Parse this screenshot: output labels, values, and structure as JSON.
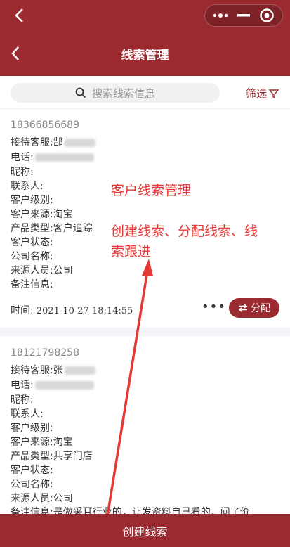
{
  "header": {
    "title": "线索管理"
  },
  "search": {
    "placeholder": "搜索线索信息",
    "filter_label": "筛选"
  },
  "cards": [
    {
      "phone": "18366856689",
      "fields": [
        {
          "label": "接待客服:",
          "value": "郜"
        },
        {
          "label": "电话:",
          "value": ""
        },
        {
          "label": "昵称:",
          "value": ""
        },
        {
          "label": "联系人:",
          "value": ""
        },
        {
          "label": "客户级别:",
          "value": ""
        },
        {
          "label": "客户来源:",
          "value": "淘宝"
        },
        {
          "label": "产品类型:",
          "value": "客户追踪"
        },
        {
          "label": "客户状态:",
          "value": ""
        },
        {
          "label": "公司名称:",
          "value": ""
        },
        {
          "label": "来源人员:",
          "value": "公司"
        },
        {
          "label": "备注信息:",
          "value": ""
        }
      ],
      "time_label": "时间:",
      "time_value": "2021-10-27 18:14:55",
      "more": "•••",
      "assign_label": "分配"
    },
    {
      "phone": "18121798258",
      "fields": [
        {
          "label": "接待客服:",
          "value": "张"
        },
        {
          "label": "电话:",
          "value": ""
        },
        {
          "label": "昵称:",
          "value": ""
        },
        {
          "label": "联系人:",
          "value": ""
        },
        {
          "label": "客户级别:",
          "value": ""
        },
        {
          "label": "客户来源:",
          "value": "淘宝"
        },
        {
          "label": "产品类型:",
          "value": "共享门店"
        },
        {
          "label": "客户状态:",
          "value": ""
        },
        {
          "label": "公司名称:",
          "value": ""
        },
        {
          "label": "来源人员:",
          "value": "公司"
        },
        {
          "label": "备注信息:",
          "value": "是做采耳行业的，让发资料自己看的，问了价"
        }
      ]
    }
  ],
  "annotations": {
    "line1": "客户线索管理",
    "line2": "创建线索、分配线索、线",
    "line3": "索跟进"
  },
  "bottom": {
    "create_label": "创建线索"
  },
  "colors": {
    "brand": "#9b2a30",
    "annotation": "#e53935"
  }
}
